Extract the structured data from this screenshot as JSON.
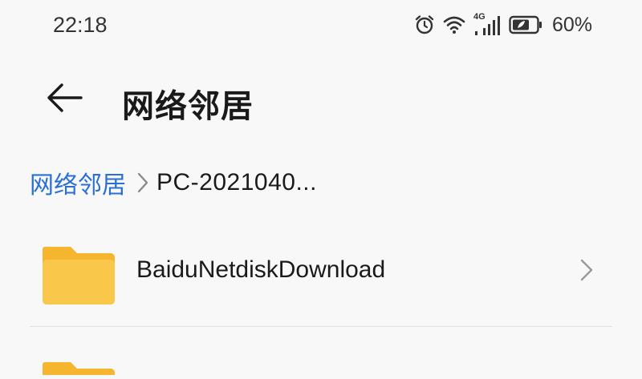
{
  "status_bar": {
    "time": "22:18",
    "network_label": "4G",
    "battery_percent": "60%",
    "icons": [
      "alarm-icon",
      "wifi-icon",
      "signal-icon",
      "battery-icon"
    ]
  },
  "header": {
    "back_icon": "arrow-left-icon",
    "title": "网络邻居"
  },
  "breadcrumb": {
    "root": "网络邻居",
    "separator_icon": "chevron-right-icon",
    "current": "PC-2021040..."
  },
  "files": [
    {
      "name": "BaiduNetdiskDownload",
      "type": "folder",
      "icon": "folder-icon"
    }
  ],
  "colors": {
    "accent": "#2a6fd6",
    "folder": "#f9c84a",
    "folder_tab": "#f5b52e",
    "background": "#f8f8f8"
  }
}
